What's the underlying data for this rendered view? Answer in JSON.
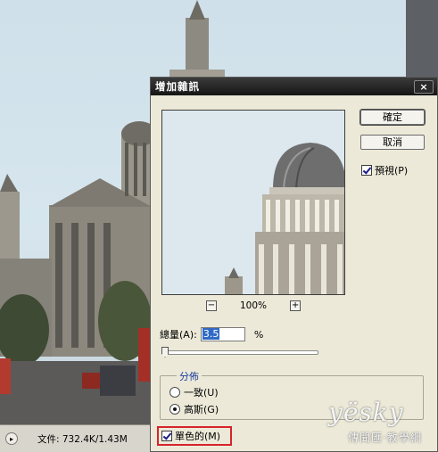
{
  "status_bar": {
    "arrow_icon": "chevron-right-icon",
    "doc_info": "文件: 732.4K/1.43M"
  },
  "dialog": {
    "title": "增加雜訊",
    "close_label": "×",
    "ok_label": "確定",
    "cancel_label": "取消",
    "preview_label": "預視(P)",
    "preview_checked": true,
    "zoom_out_label": "−",
    "zoom_in_label": "+",
    "zoom_level": "100%",
    "amount_label": "總量(A):",
    "amount_value": "3.5",
    "amount_unit": "%",
    "distribution": {
      "legend": "分佈",
      "options": [
        {
          "label": "一致(U)",
          "selected": false
        },
        {
          "label": "高斯(G)",
          "selected": true
        }
      ]
    },
    "monochromatic_label": "單色的(M)",
    "monochromatic_checked": true
  },
  "watermark": {
    "logo": "yësky",
    "sub": "傳聞匯·教學網"
  }
}
